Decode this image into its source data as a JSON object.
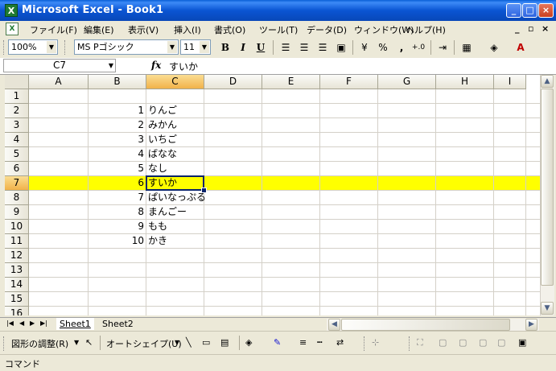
{
  "window": {
    "title": "Microsoft Excel - Book1"
  },
  "titlebar_buttons": {
    "minimize": "_",
    "maximize": "□",
    "close": "×"
  },
  "menu": {
    "items": [
      "ファイル(F)",
      "編集(E)",
      "表示(V)",
      "挿入(I)",
      "書式(O)",
      "ツール(T)",
      "データ(D)",
      "ウィンドウ(W)",
      "ヘルプ(H)"
    ],
    "mdi": {
      "minimize": "_",
      "restore": "♬",
      "close": "×"
    }
  },
  "toolbar": {
    "zoom": "100%",
    "font": "MS Pゴシック",
    "size": "11",
    "bold": "B",
    "italic": "I",
    "underline": "U",
    "percent": "%",
    "comma": ",",
    "increase_decimal": "+.0"
  },
  "formula": {
    "name_box": "C7",
    "fx_label": "fx",
    "value": "すいか"
  },
  "columns": [
    "A",
    "B",
    "C",
    "D",
    "E",
    "F",
    "G",
    "H",
    "I"
  ],
  "rows": [
    "1",
    "2",
    "3",
    "4",
    "5",
    "6",
    "7",
    "8",
    "9",
    "10",
    "11",
    "12",
    "13",
    "14",
    "15",
    "16"
  ],
  "cells": [
    {
      "row": 2,
      "num": "1",
      "text": "りんご"
    },
    {
      "row": 3,
      "num": "2",
      "text": "みかん"
    },
    {
      "row": 4,
      "num": "3",
      "text": "いちご"
    },
    {
      "row": 5,
      "num": "4",
      "text": "ばなな"
    },
    {
      "row": 6,
      "num": "5",
      "text": "なし"
    },
    {
      "row": 7,
      "num": "6",
      "text": "すいか"
    },
    {
      "row": 8,
      "num": "7",
      "text": "ぱいなっぷる"
    },
    {
      "row": 9,
      "num": "8",
      "text": "まんごー"
    },
    {
      "row": 10,
      "num": "9",
      "text": "もも"
    },
    {
      "row": 11,
      "num": "10",
      "text": "かき"
    }
  ],
  "selection": {
    "cell": "C7",
    "highlight_row": 7,
    "highlight_color": "#ffff00"
  },
  "sheets": [
    "Sheet1",
    "Sheet2"
  ],
  "drawing_toolbar": {
    "draw_menu": "図形の調整(R)",
    "autoshapes": "オートシェイプ(U)"
  },
  "status": {
    "text": "コマンド"
  },
  "colors": {
    "titlebar": "#0a55d3",
    "selection_border": "#0a246a",
    "header_selected": "#f1b24a"
  }
}
